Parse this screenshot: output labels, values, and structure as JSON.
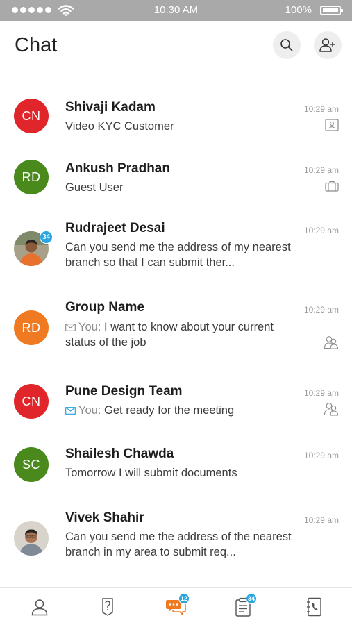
{
  "status_bar": {
    "time": "10:30 AM",
    "battery": "100%",
    "icons": [
      "signal-dots-icon",
      "wifi-icon",
      "battery-icon"
    ]
  },
  "header": {
    "title": "Chat",
    "actions": [
      {
        "icon": "search-icon"
      },
      {
        "icon": "add-user-icon"
      }
    ]
  },
  "you_prefix": "You:",
  "chats": [
    {
      "initials": "CN",
      "avatar_color": "#e0262a",
      "name": "Shivaji Kadam",
      "subtitle": "Video KYC Customer",
      "time": "10:29 am",
      "meta_icon": "id-card-icon"
    },
    {
      "initials": "RD",
      "avatar_color": "#4a8a1c",
      "name": "Ankush Pradhan",
      "subtitle": "Guest User",
      "time": "10:29 am",
      "meta_icon": "briefcase-icon"
    },
    {
      "initials": "",
      "avatar_color": "#9a8b6a",
      "name": "Rudrajeet Desai",
      "subtitle": "Can you send me the address of my nearest branch so that I can submit ther...",
      "time": "10:29 am",
      "badge": "34"
    },
    {
      "initials": "RD",
      "avatar_color": "#f07a22",
      "name": "Group Name",
      "subtitle": "I want to know about your current status of the job",
      "time": "10:29 am",
      "meta_icon": "group-icon",
      "mail_status": "read"
    },
    {
      "initials": "CN",
      "avatar_color": "#e0262a",
      "name": "Pune Design Team",
      "subtitle": "Get ready for the meeting",
      "time": "10:29 am",
      "meta_icon": "group-icon",
      "mail_status": "unread"
    },
    {
      "initials": "SC",
      "avatar_color": "#4a8a1c",
      "name": "Shailesh Chawda",
      "subtitle": "Tomorrow I will submit documents",
      "time": "10:29 am"
    },
    {
      "initials": "",
      "avatar_color": "#b8b2a8",
      "name": "Vivek Shahir",
      "subtitle": "Can you send me the address of the nearest branch in my area to submit req...",
      "time": "10:29 am"
    }
  ],
  "colors": {
    "accent": "#29a5e0",
    "active_nav": "#f07a22",
    "status_bar": "#a9a9a9"
  },
  "bottom_nav": [
    {
      "icon": "profile-icon"
    },
    {
      "icon": "help-icon"
    },
    {
      "icon": "chat-icon",
      "badge": "12",
      "active": true
    },
    {
      "icon": "tasks-icon",
      "badge": "34"
    },
    {
      "icon": "contacts-icon"
    }
  ]
}
